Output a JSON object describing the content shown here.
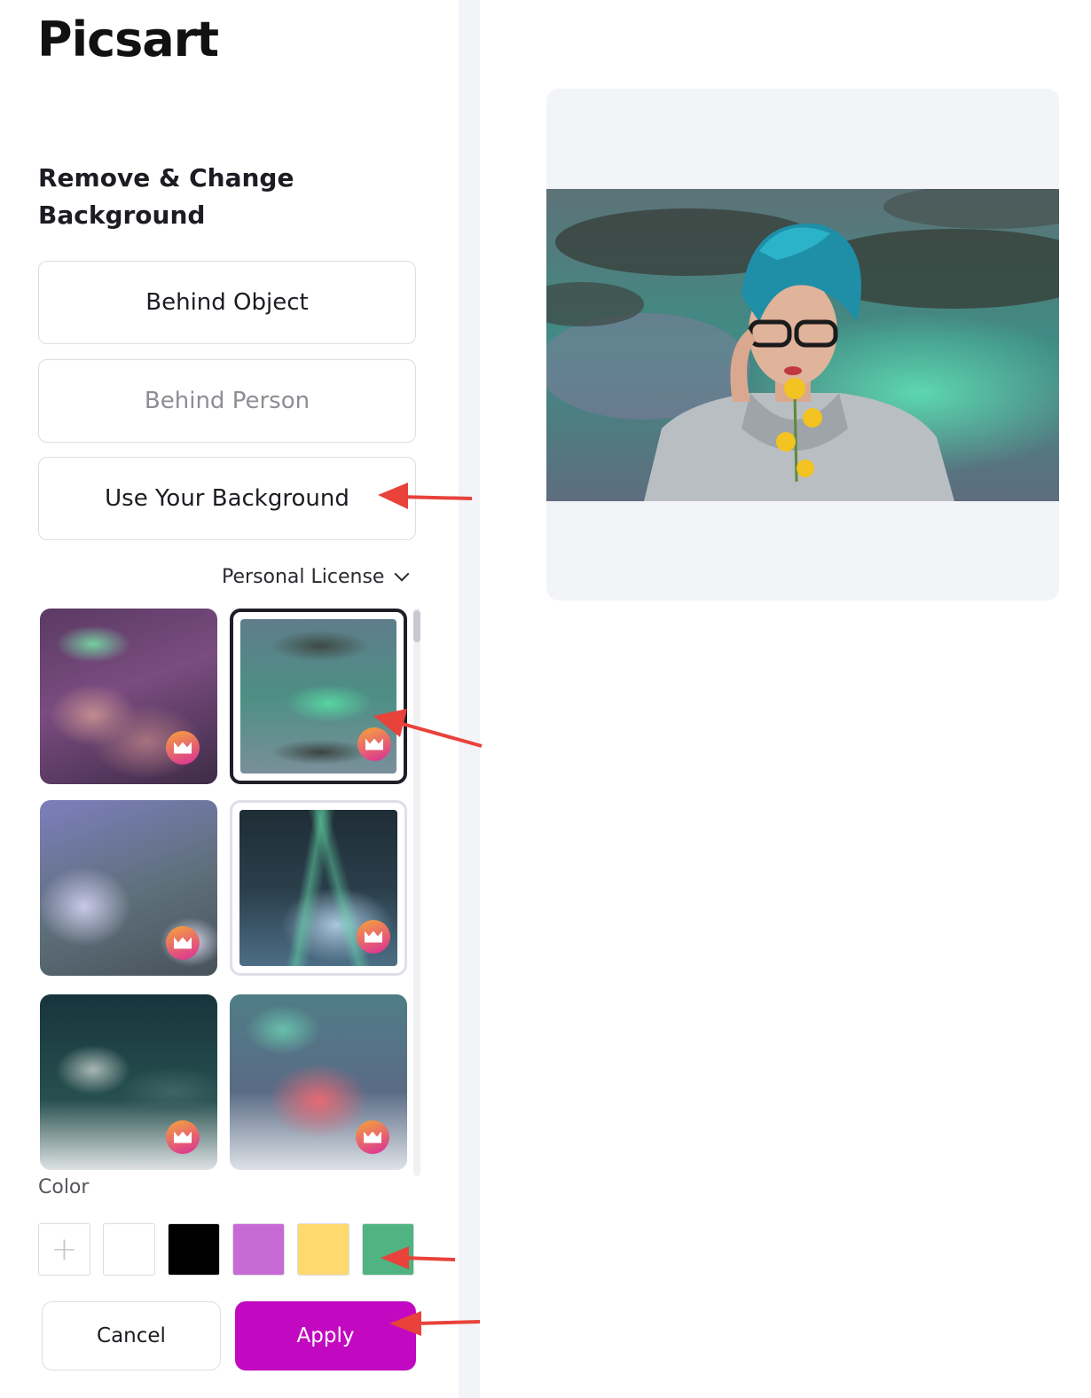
{
  "app": {
    "logo_text": "Picsart"
  },
  "panel": {
    "title": "Remove & Change Background",
    "options": [
      {
        "label": "Behind Object",
        "state": "normal"
      },
      {
        "label": "Behind Person",
        "state": "disabled"
      },
      {
        "label": "Use Your Background",
        "state": "normal"
      }
    ],
    "license_label": "Personal License",
    "backgrounds": [
      {
        "name": "purple-nebula-clouds",
        "premium": true,
        "selected": false
      },
      {
        "name": "green-aurora-clouds",
        "premium": true,
        "selected": true
      },
      {
        "name": "lavender-clouds",
        "premium": true,
        "selected": false
      },
      {
        "name": "aurora-blue-clouds",
        "premium": true,
        "selected": false
      },
      {
        "name": "teal-night-clouds",
        "premium": true,
        "selected": false
      },
      {
        "name": "pink-teal-clouds",
        "premium": true,
        "selected": false
      }
    ],
    "color_label": "Color",
    "colors": [
      "#ffffff",
      "#000000",
      "#c76ad6",
      "#ffd96e",
      "#4fb382"
    ],
    "add_color_symbol": "+",
    "cancel_label": "Cancel",
    "apply_label": "Apply"
  },
  "theme": {
    "accent": "#c209c1",
    "annotation_arrow": "#e8423b"
  }
}
